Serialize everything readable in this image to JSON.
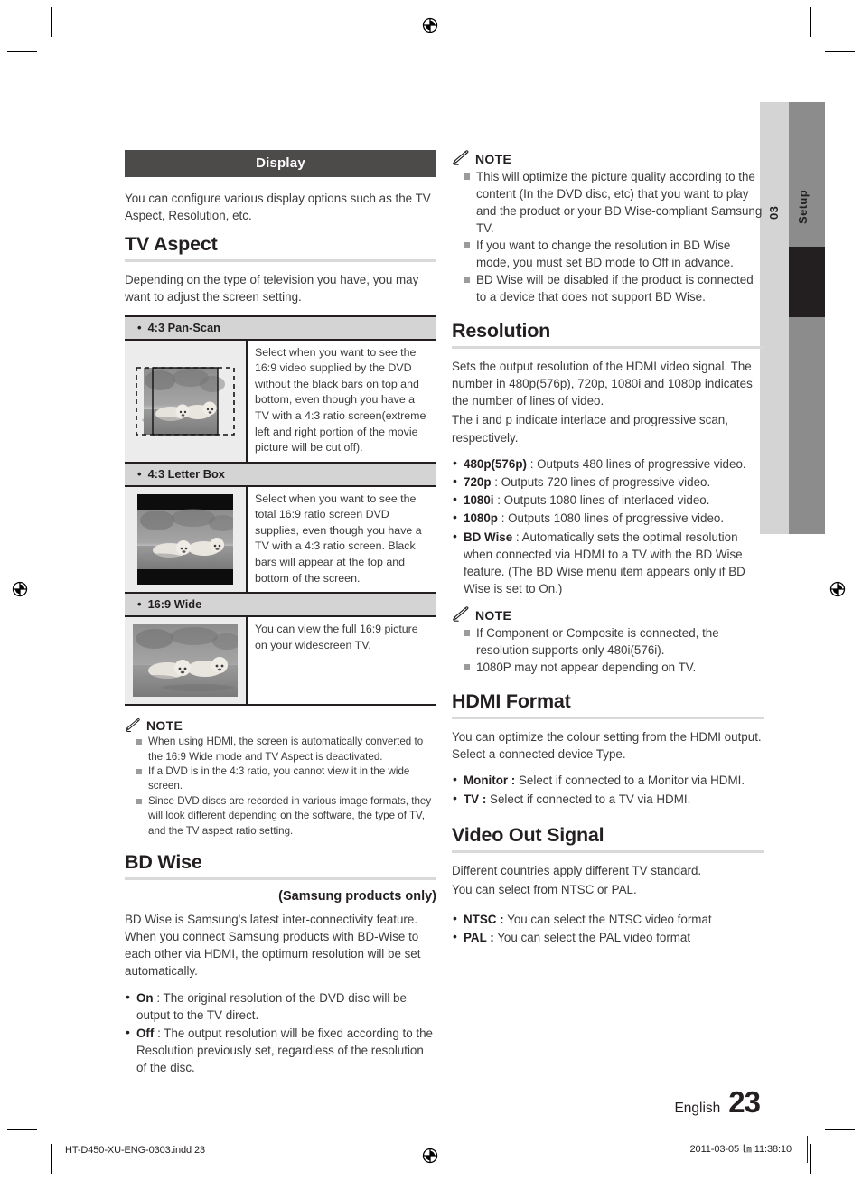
{
  "sidebar": {
    "number": "03",
    "section": "Setup"
  },
  "left": {
    "display_bar": "Display",
    "intro": "You can configure various display options such as the TV Aspect, Resolution, etc.",
    "tv_aspect": {
      "title": "TV Aspect",
      "intro": "Depending on the type of television you have, you may want to adjust the screen setting.",
      "rows": [
        {
          "label": "4:3 Pan-Scan",
          "image": "puppies-pan-scan-thumbnail",
          "desc": "Select when you want to see the 16:9 video supplied by the DVD without the black bars on top and bottom, even though you have a TV with a 4:3 ratio screen(extreme left and right portion of the movie picture will be cut off)."
        },
        {
          "label": "4:3 Letter Box",
          "image": "puppies-letter-box-thumbnail",
          "desc": "Select when you want to see the total 16:9 ratio screen DVD supplies, even though you have a TV with a 4:3 ratio screen. Black bars will appear at the top and bottom of the screen."
        },
        {
          "label": "16:9 Wide",
          "image": "puppies-wide-thumbnail",
          "desc": "You can view the full 16:9 picture on your widescreen TV."
        }
      ]
    },
    "note_label": "NOTE",
    "aspect_notes": [
      "When using HDMI, the screen is automatically converted to the 16:9 Wide mode and TV Aspect is deactivated.",
      "If a DVD is in the 4:3 ratio, you cannot view it in the wide screen.",
      "Since DVD discs are recorded in various image formats, they will look different depending on the software, the type of TV, and the TV aspect ratio setting."
    ],
    "bd_wise": {
      "title": "BD Wise",
      "samsung_only": "(Samsung products only)",
      "intro": "BD Wise is Samsung's latest inter-connectivity feature. When you connect Samsung products with BD-Wise to each other via HDMI, the optimum resolution will be set automatically.",
      "options": [
        {
          "term": "On",
          "desc": " : The original resolution of the DVD disc will be output to the TV direct."
        },
        {
          "term": "Off",
          "desc": " : The output resolution will be fixed according to the Resolution previously set, regardless of the resolution of the disc."
        }
      ]
    }
  },
  "right": {
    "note_label": "NOTE",
    "bd_wise_notes": [
      "This will optimize the picture quality according to the content (In the DVD disc, etc) that you want to play and the product or your BD Wise-compliant Samsung TV.",
      "If you want to change the resolution in BD Wise mode, you must set BD mode to Off in advance.",
      "BD Wise will be disabled if the product is connected to a device that does not support BD Wise."
    ],
    "resolution": {
      "title": "Resolution",
      "intro1": "Sets the output resolution of the HDMI video signal. The number in 480p(576p), 720p, 1080i and 1080p indicates the number of lines of video.",
      "intro2": "The i and p indicate interlace and progressive scan, respectively.",
      "options": [
        {
          "term": "480p(576p)",
          "desc": " : Outputs 480 lines of progressive video."
        },
        {
          "term": "720p",
          "desc": " : Outputs 720 lines of progressive video."
        },
        {
          "term": "1080i",
          "desc": " : Outputs 1080 lines of interlaced video."
        },
        {
          "term": "1080p",
          "desc": " : Outputs 1080 lines of progressive video."
        },
        {
          "term": "BD Wise",
          "desc": " : Automatically sets the optimal resolution when connected via HDMI to a TV with the BD Wise feature. (The BD Wise menu item appears only if BD Wise is set to On.)"
        }
      ],
      "notes": [
        "If Component or Composite is connected, the resolution supports only 480i(576i).",
        "1080P may not appear depending on TV."
      ]
    },
    "hdmi_format": {
      "title": "HDMI Format",
      "intro": "You can optimize the colour setting from the HDMI output. Select a connected device Type.",
      "options": [
        {
          "term": "Monitor :",
          "desc": " Select if connected to a Monitor via HDMI."
        },
        {
          "term": "TV :",
          "desc": " Select if connected to a TV via HDMI."
        }
      ]
    },
    "video_out": {
      "title": "Video Out Signal",
      "intro1": "Different countries apply different TV standard.",
      "intro2": "You can select from NTSC or PAL.",
      "options": [
        {
          "term": "NTSC :",
          "desc": " You can select the NTSC video format"
        },
        {
          "term": "PAL :",
          "desc": " You can select the PAL video format"
        }
      ]
    }
  },
  "footer": {
    "language": "English",
    "page_number": "23",
    "file_name": "HT-D450-XU-ENG-0303.indd   23",
    "timestamp": "2011-03-05   ㏐ 11:38:10"
  },
  "colors": {
    "bar_background": "#4d4a4a",
    "table_label_background": "#d4d4d4",
    "tab_light": "#d4d4d4",
    "tab_dark": "#8c8c8c",
    "tab_black": "#231f20",
    "rule": "#d9d9d9"
  }
}
